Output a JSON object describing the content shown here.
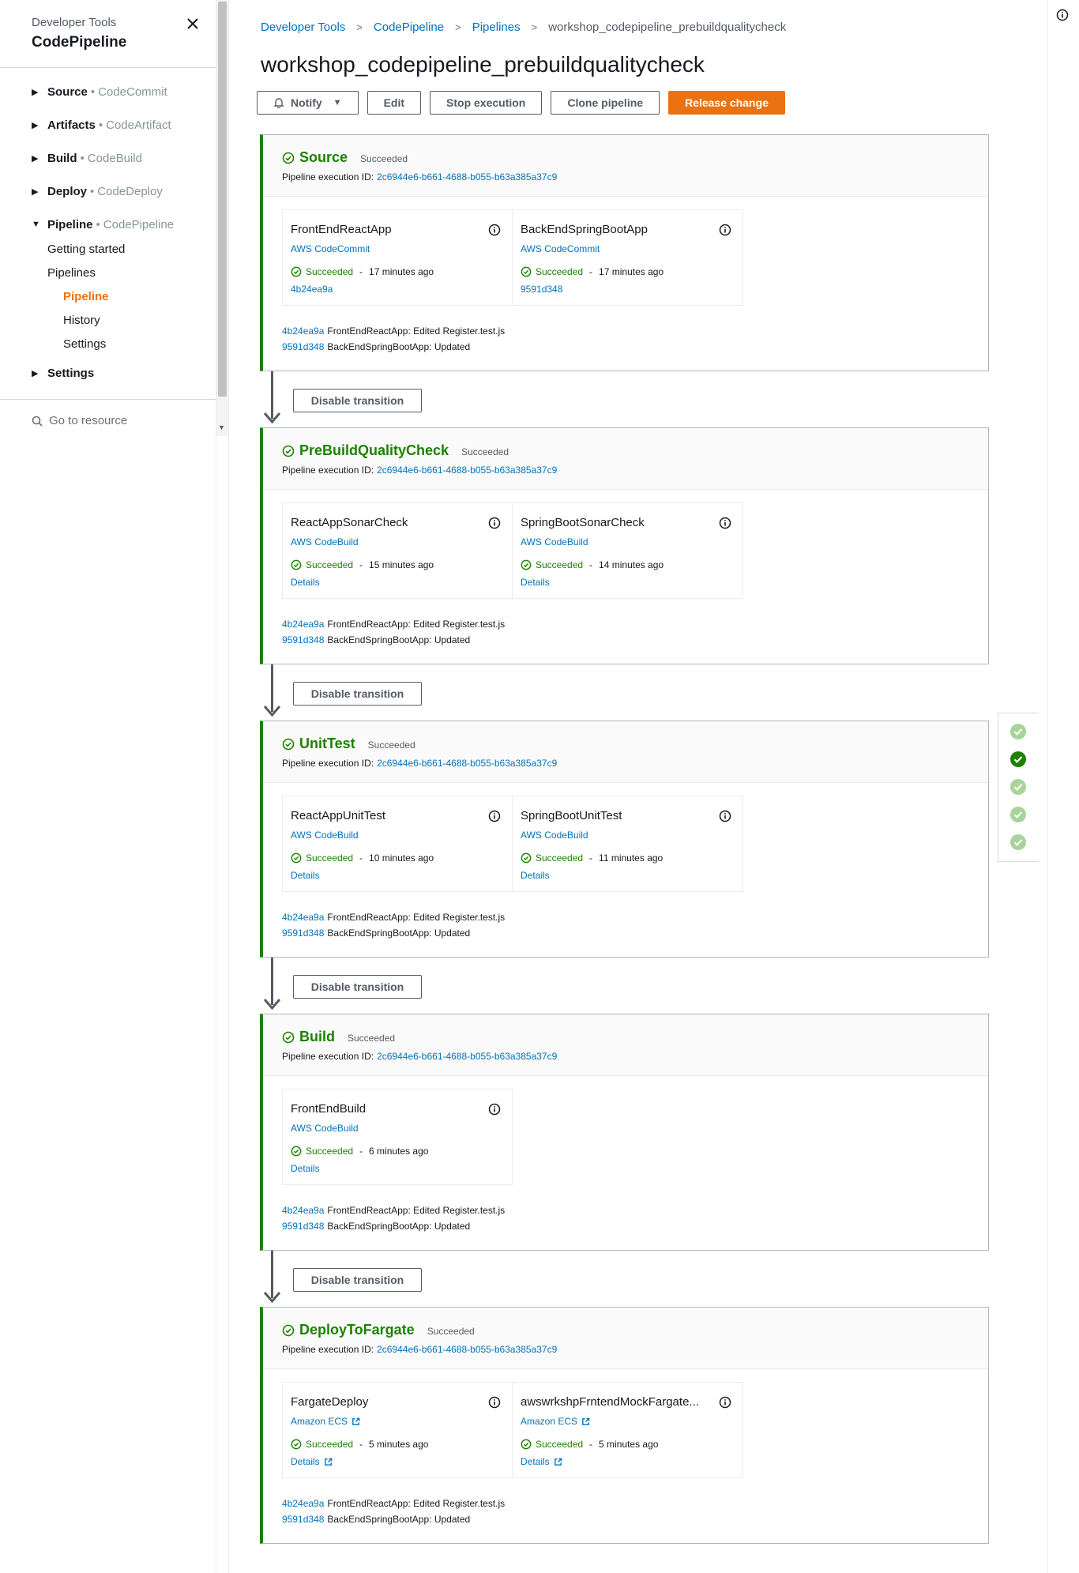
{
  "sidebar": {
    "kicker": "Developer Tools",
    "title": "CodePipeline",
    "groups": [
      {
        "label": "Source",
        "service": "CodeCommit",
        "expanded": false
      },
      {
        "label": "Artifacts",
        "service": "CodeArtifact",
        "expanded": false
      },
      {
        "label": "Build",
        "service": "CodeBuild",
        "expanded": false
      },
      {
        "label": "Deploy",
        "service": "CodeDeploy",
        "expanded": false
      },
      {
        "label": "Pipeline",
        "service": "CodePipeline",
        "expanded": true
      }
    ],
    "pipeline_items": [
      "Getting started",
      "Pipelines"
    ],
    "pipeline_sub_items": [
      "Pipeline",
      "History",
      "Settings"
    ],
    "settings_group": "Settings",
    "search": "Go to resource",
    "separator": "•"
  },
  "breadcrumb": {
    "items": [
      "Developer Tools",
      "CodePipeline",
      "Pipelines"
    ],
    "current": "workshop_codepipeline_prebuildqualitycheck"
  },
  "page": {
    "title": "workshop_codepipeline_prebuildqualitycheck"
  },
  "toolbar": {
    "notify": "Notify",
    "edit": "Edit",
    "stop": "Stop execution",
    "clone": "Clone pipeline",
    "release": "Release change"
  },
  "exec_label": "Pipeline execution ID:",
  "transition_label": "Disable transition",
  "colors": {
    "success": "#1d8102",
    "link": "#0073bb",
    "accent": "#ec7211"
  },
  "stages": [
    {
      "name": "Source",
      "status": "Succeeded",
      "exec_id": "2c6944e6-b661-4688-b055-b63a385a37c9",
      "actions": [
        {
          "name": "FrontEndReactApp",
          "provider": "AWS CodeCommit",
          "status": "Succeeded",
          "time": "17 minutes ago",
          "footer": "4b24ea9a",
          "external": false
        },
        {
          "name": "BackEndSpringBootApp",
          "provider": "AWS CodeCommit",
          "status": "Succeeded",
          "time": "17 minutes ago",
          "footer": "9591d348",
          "external": false
        }
      ],
      "commits": [
        {
          "id": "4b24ea9a",
          "msg": "FrontEndReactApp: Edited Register.test.js"
        },
        {
          "id": "9591d348",
          "msg": "BackEndSpringBootApp: Updated"
        }
      ]
    },
    {
      "name": "PreBuildQualityCheck",
      "status": "Succeeded",
      "exec_id": "2c6944e6-b661-4688-b055-b63a385a37c9",
      "actions": [
        {
          "name": "ReactAppSonarCheck",
          "provider": "AWS CodeBuild",
          "status": "Succeeded",
          "time": "15 minutes ago",
          "footer": "Details",
          "external": false
        },
        {
          "name": "SpringBootSonarCheck",
          "provider": "AWS CodeBuild",
          "status": "Succeeded",
          "time": "14 minutes ago",
          "footer": "Details",
          "external": false
        }
      ],
      "commits": [
        {
          "id": "4b24ea9a",
          "msg": "FrontEndReactApp: Edited Register.test.js"
        },
        {
          "id": "9591d348",
          "msg": "BackEndSpringBootApp: Updated"
        }
      ]
    },
    {
      "name": "UnitTest",
      "status": "Succeeded",
      "exec_id": "2c6944e6-b661-4688-b055-b63a385a37c9",
      "actions": [
        {
          "name": "ReactAppUnitTest",
          "provider": "AWS CodeBuild",
          "status": "Succeeded",
          "time": "10 minutes ago",
          "footer": "Details",
          "external": false
        },
        {
          "name": "SpringBootUnitTest",
          "provider": "AWS CodeBuild",
          "status": "Succeeded",
          "time": "11 minutes ago",
          "footer": "Details",
          "external": false
        }
      ],
      "commits": [
        {
          "id": "4b24ea9a",
          "msg": "FrontEndReactApp: Edited Register.test.js"
        },
        {
          "id": "9591d348",
          "msg": "BackEndSpringBootApp: Updated"
        }
      ]
    },
    {
      "name": "Build",
      "status": "Succeeded",
      "exec_id": "2c6944e6-b661-4688-b055-b63a385a37c9",
      "actions": [
        {
          "name": "FrontEndBuild",
          "provider": "AWS CodeBuild",
          "status": "Succeeded",
          "time": "6 minutes ago",
          "footer": "Details",
          "external": false
        }
      ],
      "commits": [
        {
          "id": "4b24ea9a",
          "msg": "FrontEndReactApp: Edited Register.test.js"
        },
        {
          "id": "9591d348",
          "msg": "BackEndSpringBootApp: Updated"
        }
      ]
    },
    {
      "name": "DeployToFargate",
      "status": "Succeeded",
      "exec_id": "2c6944e6-b661-4688-b055-b63a385a37c9",
      "actions": [
        {
          "name": "FargateDeploy",
          "provider": "Amazon ECS",
          "status": "Succeeded",
          "time": "5 minutes ago",
          "footer": "Details",
          "external": true
        },
        {
          "name": "awswrkshpFrntendMockFargate...",
          "provider": "Amazon ECS",
          "status": "Succeeded",
          "time": "5 minutes ago",
          "footer": "Details",
          "external": true
        }
      ],
      "commits": [
        {
          "id": "4b24ea9a",
          "msg": "FrontEndReactApp: Edited Register.test.js"
        },
        {
          "id": "9591d348",
          "msg": "BackEndSpringBootApp: Updated"
        }
      ]
    }
  ],
  "minimap": {
    "current_index": 1,
    "count": 5
  }
}
